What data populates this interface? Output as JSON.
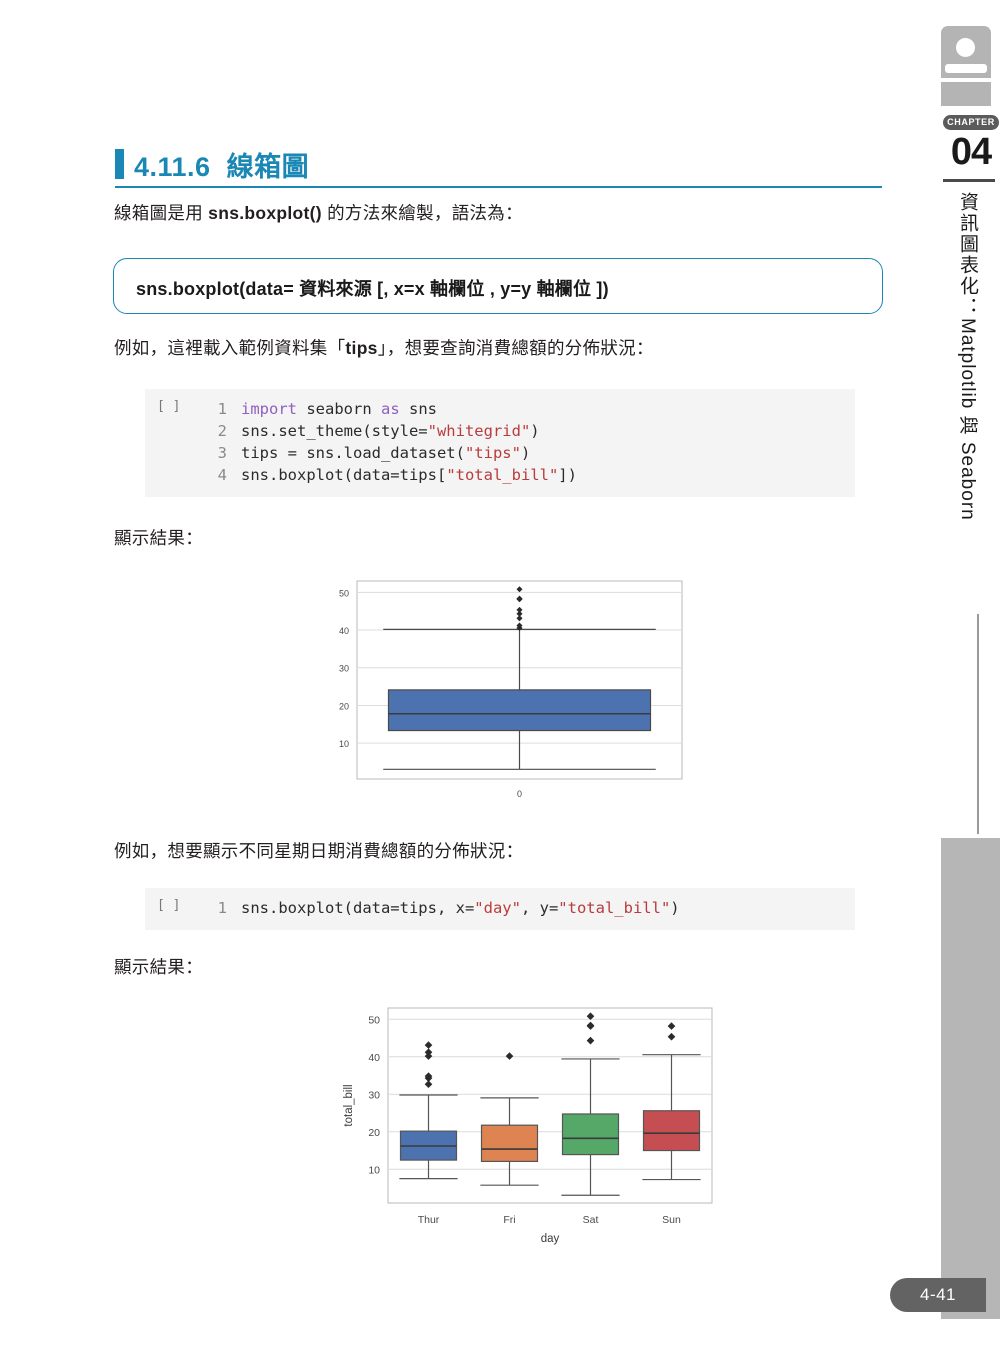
{
  "page": {
    "number": "4-41",
    "chapter_label": "CHAPTER",
    "chapter_number": "04",
    "vertical_title_cjk": "資訊圖表化：",
    "vertical_title_latin": "Matplotlib 與 Seaborn"
  },
  "heading": {
    "number": "4.11.6",
    "title": "線箱圖",
    "accent_color": "#1a87b5"
  },
  "paragraphs": {
    "intro_pre": "線箱圖是用 ",
    "intro_bold": "sns.boxplot()",
    "intro_post": " 的方法來繪製，語法為：",
    "example1": "例如，這裡載入範例資料集「",
    "example1_bold": "tips",
    "example1_post": "」，想要查詢消費總額的分佈狀況：",
    "result1": "顯示結果：",
    "example2": "例如，想要顯示不同星期日期消費總額的分佈狀況：",
    "result2": "顯示結果："
  },
  "syntax_box": {
    "text": "sns.boxplot(data= 資料來源 [, x=x 軸欄位 , y=y 軸欄位 ])"
  },
  "code_block_1": {
    "prompt": "[ ]",
    "lines": [
      {
        "n": "1",
        "parts": [
          {
            "t": "import ",
            "c": "kw"
          },
          {
            "t": "seaborn ",
            "c": ""
          },
          {
            "t": "as ",
            "c": "kw"
          },
          {
            "t": "sns",
            "c": ""
          }
        ]
      },
      {
        "n": "2",
        "parts": [
          {
            "t": "sns.set_theme(style=",
            "c": ""
          },
          {
            "t": "\"whitegrid\"",
            "c": "str"
          },
          {
            "t": ")",
            "c": ""
          }
        ]
      },
      {
        "n": "3",
        "parts": [
          {
            "t": "tips = sns.load_dataset(",
            "c": ""
          },
          {
            "t": "\"tips\"",
            "c": "str"
          },
          {
            "t": ")",
            "c": ""
          }
        ]
      },
      {
        "n": "4",
        "parts": [
          {
            "t": "sns.boxplot(data=tips[",
            "c": ""
          },
          {
            "t": "\"total_bill\"",
            "c": "str"
          },
          {
            "t": "])",
            "c": ""
          }
        ]
      }
    ]
  },
  "code_block_2": {
    "prompt": "[ ]",
    "lines": [
      {
        "n": "1",
        "parts": [
          {
            "t": "sns.boxplot(data=tips, x=",
            "c": ""
          },
          {
            "t": "\"day\"",
            "c": "str"
          },
          {
            "t": ", y=",
            "c": ""
          },
          {
            "t": "\"total_bill\"",
            "c": "str"
          },
          {
            "t": ")",
            "c": ""
          }
        ]
      }
    ]
  },
  "chart_data": [
    {
      "type": "box",
      "orientation": "vertical",
      "title": "",
      "xlabel": "",
      "ylabel": "",
      "xtick_labels": [
        "0"
      ],
      "yticks": [
        10,
        20,
        30,
        40,
        50
      ],
      "ylim": [
        0.5,
        53
      ],
      "grid": "horizontal",
      "box_color": "#4c72b0",
      "boxes": [
        {
          "category": "0",
          "q1": 13.35,
          "median": 17.8,
          "q3": 24.13,
          "whisker_low": 3.07,
          "whisker_high": 40.17,
          "outliers": [
            40.55,
            41.19,
            43.11,
            44.3,
            45.35,
            48.17,
            48.27,
            48.33,
            50.81
          ]
        }
      ]
    },
    {
      "type": "box",
      "orientation": "vertical",
      "title": "",
      "xlabel": "day",
      "ylabel": "total_bill",
      "xtick_labels": [
        "Thur",
        "Fri",
        "Sat",
        "Sun"
      ],
      "yticks": [
        10,
        20,
        30,
        40,
        50
      ],
      "ylim": [
        1.0,
        53
      ],
      "grid": "horizontal",
      "palette": [
        "#4c72b0",
        "#dd8452",
        "#55a868",
        "#c44e52"
      ],
      "boxes": [
        {
          "category": "Thur",
          "color": "#4c72b0",
          "q1": 12.44,
          "median": 16.2,
          "q3": 20.16,
          "whisker_low": 7.51,
          "whisker_high": 29.8,
          "outliers": [
            32.68,
            34.3,
            34.83,
            40.17,
            41.19,
            43.11
          ]
        },
        {
          "category": "Fri",
          "color": "#dd8452",
          "q1": 12.09,
          "median": 15.38,
          "q3": 21.75,
          "whisker_low": 5.75,
          "whisker_high": 29.03,
          "outliers": [
            40.17
          ]
        },
        {
          "category": "Sat",
          "color": "#55a868",
          "q1": 13.91,
          "median": 18.24,
          "q3": 24.74,
          "whisker_low": 3.07,
          "whisker_high": 39.42,
          "outliers": [
            44.3,
            48.17,
            48.33,
            50.81
          ]
        },
        {
          "category": "Sun",
          "color": "#c44e52",
          "q1": 14.99,
          "median": 19.63,
          "q3": 25.6,
          "whisker_low": 7.25,
          "whisker_high": 40.55,
          "outliers": [
            45.35,
            48.17
          ]
        }
      ]
    }
  ]
}
